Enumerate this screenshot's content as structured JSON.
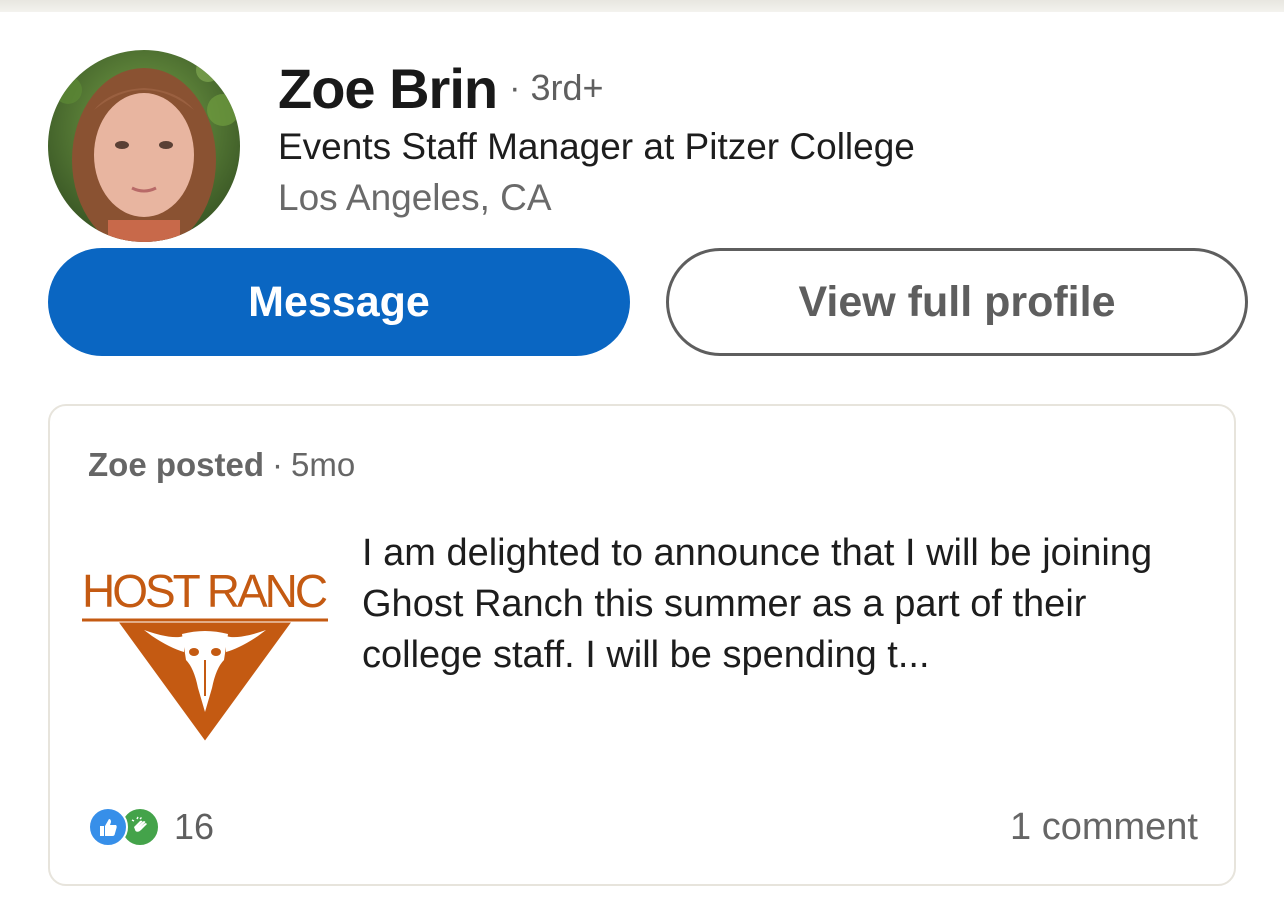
{
  "profile": {
    "name": "Zoe Brin",
    "degree_separator": "·",
    "degree": "3rd+",
    "headline": "Events Staff Manager at Pitzer College",
    "location": "Los Angeles, CA"
  },
  "actions": {
    "message_label": "Message",
    "view_profile_label": "View full profile"
  },
  "post": {
    "author_label": "Zoe posted",
    "separator": "·",
    "age": "5mo",
    "image_logo_text": "HOST RANC",
    "text": "I am delighted to announce that I will be joining Ghost Ranch this summer as a part of their college staff.  I will be spending t...",
    "reaction_count": "16",
    "reaction_icons": [
      "like-icon",
      "clap-icon"
    ],
    "comments_label": "1 comment"
  },
  "colors": {
    "primary_blue": "#0a66c2",
    "like_blue": "#378fe9",
    "clap_green": "#44a34a",
    "logo_orange": "#c45a12"
  }
}
